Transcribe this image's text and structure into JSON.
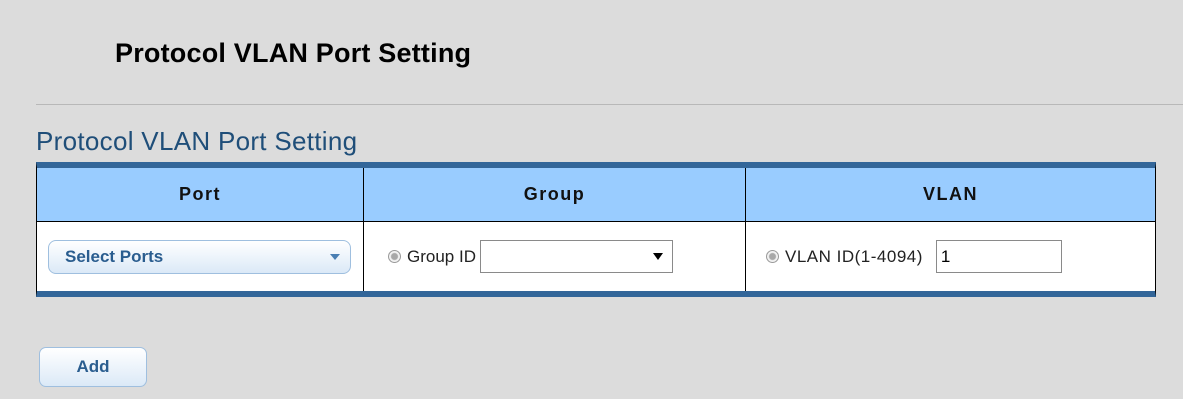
{
  "page": {
    "title": "Protocol VLAN Port Setting",
    "section_title": "Protocol VLAN Port Setting"
  },
  "table": {
    "headers": {
      "port": "Port",
      "group": "Group",
      "vlan": "VLAN"
    },
    "row": {
      "port_select_label": "Select Ports",
      "group_radio_label": "Group ID",
      "group_selected": "",
      "vlan_radio_label": "VLAN ID(1-4094)",
      "vlan_value": "1"
    }
  },
  "actions": {
    "add_label": "Add"
  },
  "colors": {
    "header_bg": "#99ccff",
    "table_border": "#336699",
    "section_title": "#1f4e79",
    "page_bg": "#dcdcdc"
  }
}
